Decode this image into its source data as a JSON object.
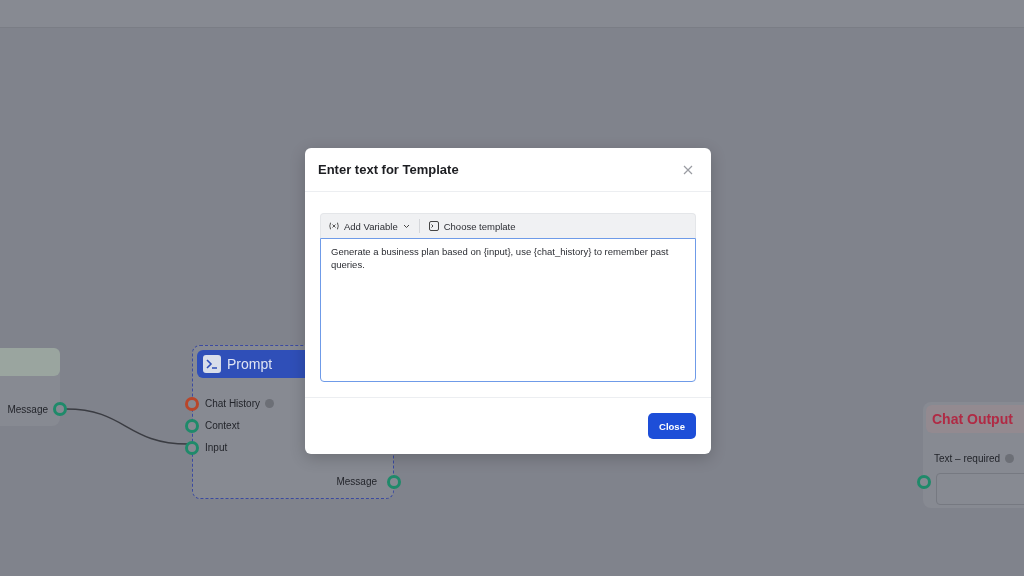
{
  "nodes": [
    {
      "kind": "source",
      "outputs": [
        {
          "label": "Message"
        }
      ]
    },
    {
      "kind": "prompt",
      "title": "Prompt",
      "inputs": [
        {
          "label": "Chat History",
          "info": true,
          "color": "#b8462a"
        },
        {
          "label": "Context",
          "info": false,
          "color": "#1f8a6a"
        },
        {
          "label": "Input",
          "info": false,
          "color": "#1f8a6a"
        }
      ],
      "outputs": [
        {
          "label": "Message"
        }
      ]
    },
    {
      "kind": "output",
      "title": "Chat Output",
      "field_label": "Text – required"
    }
  ],
  "modal": {
    "title": "Enter text for Template",
    "toolbar": [
      {
        "kind": "variable",
        "label": "Add Variable"
      },
      {
        "kind": "template",
        "label": "Choose template"
      }
    ],
    "text": "Generate a business plan based on {input}, use {chat_history} to remember past queries.",
    "button": "Close"
  }
}
